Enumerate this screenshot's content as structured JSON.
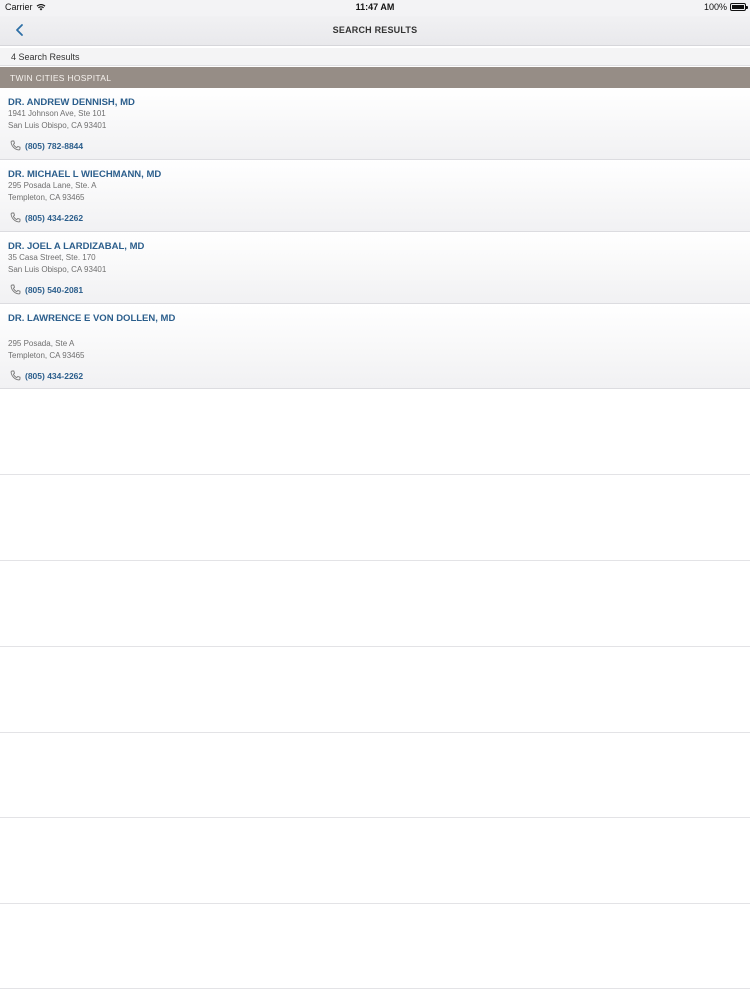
{
  "status_bar": {
    "carrier": "Carrier",
    "time": "11:47 AM",
    "battery": "100%"
  },
  "nav": {
    "title": "SEARCH RESULTS",
    "back_icon": "chevron-left-icon"
  },
  "results_count": "4 Search Results",
  "section": "TWIN CITIES HOSPITAL",
  "doctors": [
    {
      "name": "DR. ANDREW DENNISH, MD",
      "address1": "1941 Johnson Ave, Ste 101",
      "address2": "San Luis Obispo, CA 93401",
      "phone": "(805) 782-8844"
    },
    {
      "name": "DR. MICHAEL L WIECHMANN, MD",
      "address1": "295 Posada Lane, Ste. A",
      "address2": "Templeton, CA 93465",
      "phone": "(805) 434-2262"
    },
    {
      "name": "DR. JOEL A LARDIZABAL, MD",
      "address1": "35 Casa Street, Ste. 170",
      "address2": "San Luis Obispo, CA 93401",
      "phone": "(805) 540-2081"
    },
    {
      "name": "DR. LAWRENCE E VON DOLLEN, MD",
      "address1": "295 Posada, Ste A",
      "address2": "Templeton, CA 93465",
      "phone": "(805) 434-2262"
    }
  ],
  "colors": {
    "accent": "#2b5e8c",
    "section_bg": "#968d86"
  }
}
